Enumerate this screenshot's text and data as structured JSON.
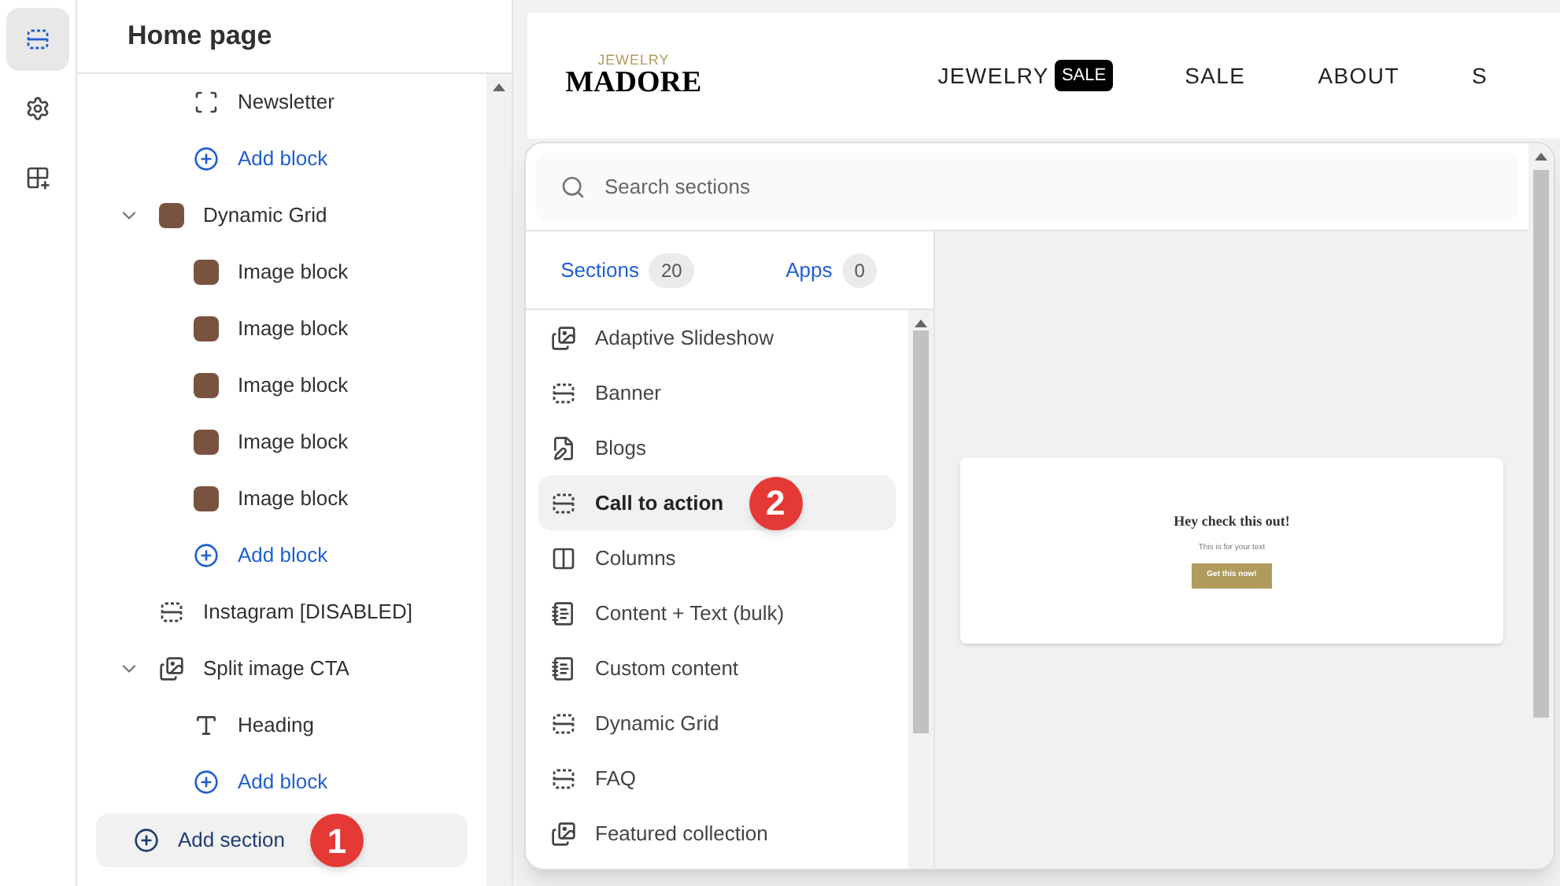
{
  "rail": [
    {
      "kind": "sections",
      "selected": true
    },
    {
      "kind": "settings",
      "selected": false
    },
    {
      "kind": "apps",
      "selected": false
    }
  ],
  "panel": {
    "title": "Home page",
    "tree": [
      {
        "kind": "cut",
        "children": [
          {
            "kind": "newsletter",
            "label": "Newsletter"
          },
          {
            "kind": "add",
            "label": "Add block"
          }
        ]
      },
      {
        "kind": "grid",
        "label": "Dynamic Grid",
        "expanded": true,
        "children": [
          {
            "kind": "image",
            "label": "Image block"
          },
          {
            "kind": "image",
            "label": "Image block"
          },
          {
            "kind": "image",
            "label": "Image block"
          },
          {
            "kind": "image",
            "label": "Image block"
          },
          {
            "kind": "image",
            "label": "Image block"
          },
          {
            "kind": "add",
            "label": "Add block"
          }
        ]
      },
      {
        "kind": "section",
        "label": "Instagram [DISABLED]"
      },
      {
        "kind": "split",
        "label": "Split image CTA",
        "expanded": true,
        "children": [
          {
            "kind": "heading",
            "label": "Heading"
          },
          {
            "kind": "add",
            "label": "Add block"
          }
        ]
      }
    ],
    "add_section": {
      "label": "Add section",
      "step": "1"
    }
  },
  "store": {
    "logo_top": "JEWELRY",
    "logo": "MADORE",
    "nav": [
      {
        "label": "JEWELRY",
        "badge": "SALE"
      },
      {
        "label": "SALE"
      },
      {
        "label": "ABOUT"
      },
      {
        "label": "S"
      }
    ]
  },
  "picker": {
    "search": {
      "placeholder": "Search sections"
    },
    "tabs": [
      {
        "label": "Sections",
        "count": "20"
      },
      {
        "label": "Apps",
        "count": "0"
      }
    ],
    "items": [
      {
        "kind": "slideshow",
        "label": "Adaptive Slideshow",
        "selected": false
      },
      {
        "kind": "section",
        "label": "Banner",
        "selected": false
      },
      {
        "kind": "blog",
        "label": "Blogs",
        "selected": false
      },
      {
        "kind": "section",
        "label": "Call to action",
        "selected": true,
        "step": "2"
      },
      {
        "kind": "columns",
        "label": "Columns",
        "selected": false
      },
      {
        "kind": "content",
        "label": "Content + Text (bulk)",
        "selected": false
      },
      {
        "kind": "content",
        "label": "Custom content",
        "selected": false
      },
      {
        "kind": "section",
        "label": "Dynamic Grid",
        "selected": false
      },
      {
        "kind": "section",
        "label": "FAQ",
        "selected": false
      },
      {
        "kind": "featured",
        "label": "Featured collection",
        "selected": false
      }
    ],
    "preview": {
      "heading": "Hey check this out!",
      "text": "This is for your text",
      "button": "Get this now!"
    }
  }
}
